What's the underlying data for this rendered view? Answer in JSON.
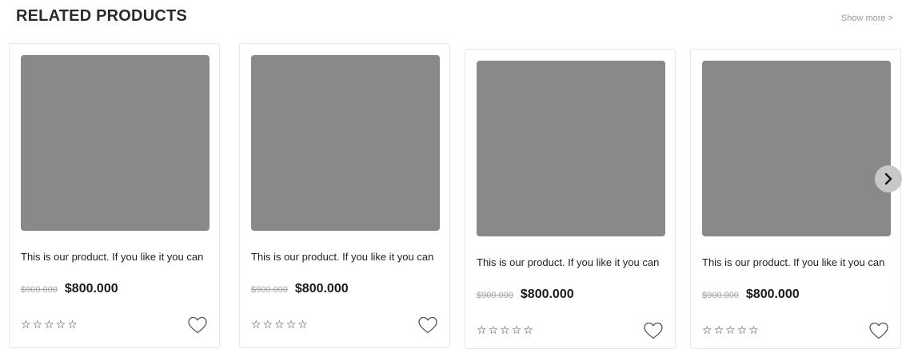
{
  "section": {
    "title": "RELATED PRODUCTS",
    "show_more": "Show more >"
  },
  "products": [
    {
      "title": "This is our product. If you like it you can",
      "old_price": "$900.000",
      "new_price": "$800.000",
      "rating": 0,
      "rating_max": 5
    },
    {
      "title": "This is our product. If you like it you can",
      "old_price": "$900.000",
      "new_price": "$800.000",
      "rating": 0,
      "rating_max": 5
    },
    {
      "title": "This is our product. If you like it you can",
      "old_price": "$900.000",
      "new_price": "$800.000",
      "rating": 0,
      "rating_max": 5
    },
    {
      "title": "This is our product. If you like it you can",
      "old_price": "$900.000",
      "new_price": "$800.000",
      "rating": 0,
      "rating_max": 5
    }
  ],
  "icons": {
    "star": "star-outline-icon",
    "favorite": "heart-outline-icon",
    "next": "chevron-right-icon"
  },
  "colors": {
    "image_placeholder": "#898989",
    "arrow_background": "#c8c8c8"
  }
}
